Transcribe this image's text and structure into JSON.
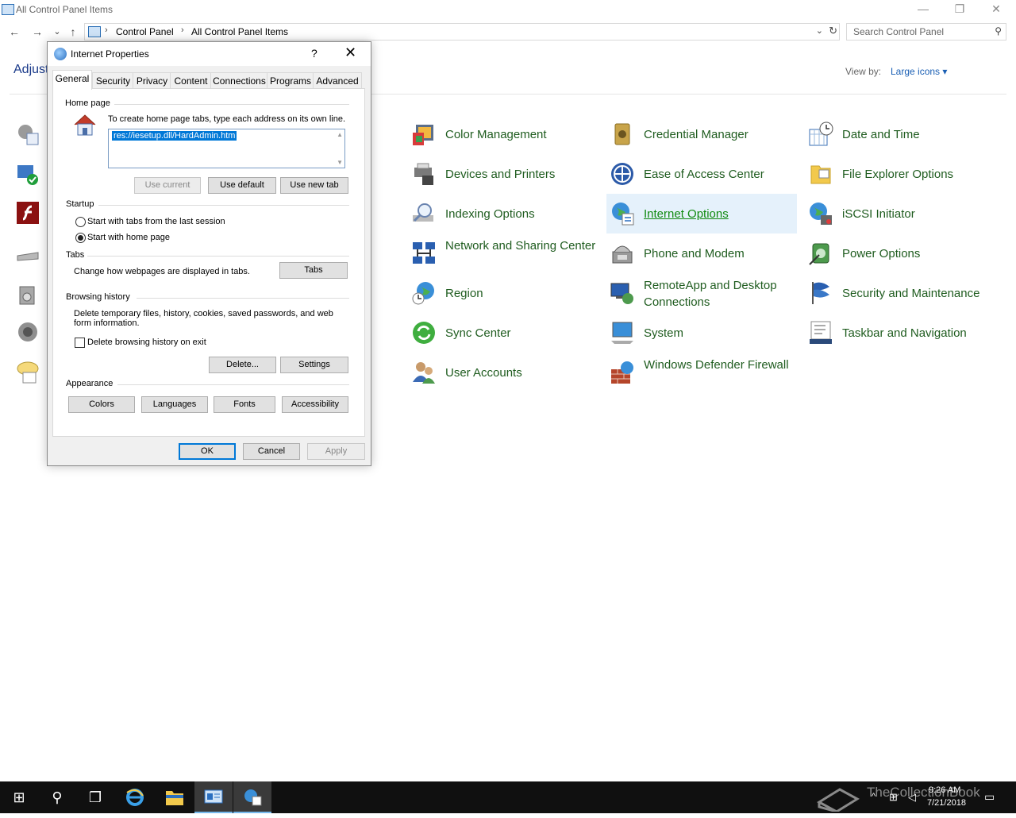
{
  "window": {
    "title": "All Control Panel Items",
    "minimize": "—",
    "restore": "❐",
    "close": "✕"
  },
  "nav": {
    "back": "←",
    "forward": "→",
    "recent": "⌄",
    "up": "↑",
    "breadcrumb": [
      "Control Panel",
      "All Control Panel Items"
    ],
    "sep": "›",
    "dropdown": "⌄",
    "refresh": "↻",
    "search_placeholder": "Search Control Panel",
    "search_glyph": "⚲"
  },
  "header": {
    "adjust": "Adjust",
    "view_by_label": "View by:",
    "view_by_value": "Large icons ▾"
  },
  "items": [
    {
      "label": "Color Management",
      "icon": "color-management-icon"
    },
    {
      "label": "Credential Manager",
      "icon": "credential-manager-icon"
    },
    {
      "label": "Date and Time",
      "icon": "date-time-icon"
    },
    {
      "label": "Devices and Printers",
      "icon": "devices-printers-icon"
    },
    {
      "label": "Ease of Access Center",
      "icon": "ease-of-access-icon"
    },
    {
      "label": "File Explorer Options",
      "icon": "file-explorer-options-icon"
    },
    {
      "label": "Indexing Options",
      "icon": "indexing-options-icon"
    },
    {
      "label": "Internet Options",
      "icon": "internet-options-icon"
    },
    {
      "label": "iSCSI Initiator",
      "icon": "iscsi-initiator-icon"
    },
    {
      "label": "Network and Sharing Center",
      "icon": "network-sharing-icon"
    },
    {
      "label": "Phone and Modem",
      "icon": "phone-modem-icon"
    },
    {
      "label": "Power Options",
      "icon": "power-options-icon"
    },
    {
      "label": "Region",
      "icon": "region-icon"
    },
    {
      "label": "RemoteApp and Desktop Connections",
      "icon": "remoteapp-icon"
    },
    {
      "label": "Security and Maintenance",
      "icon": "security-maintenance-icon"
    },
    {
      "label": "Sync Center",
      "icon": "sync-center-icon"
    },
    {
      "label": "System",
      "icon": "system-icon"
    },
    {
      "label": "Taskbar and Navigation",
      "icon": "taskbar-navigation-icon"
    },
    {
      "label": "User Accounts",
      "icon": "user-accounts-icon"
    },
    {
      "label": "Windows Defender Firewall",
      "icon": "firewall-icon"
    }
  ],
  "dialog": {
    "title": "Internet Properties",
    "help": "?",
    "close": "✕",
    "tabs": [
      "General",
      "Security",
      "Privacy",
      "Content",
      "Connections",
      "Programs",
      "Advanced"
    ],
    "home_page": {
      "group": "Home page",
      "instructions": "To create home page tabs, type each address on its own line.",
      "url": "res://iesetup.dll/HardAdmin.htm",
      "scroll_up": "▲",
      "scroll_down": "▼",
      "use_current": "Use current",
      "use_default": "Use default",
      "use_new_tab": "Use new tab"
    },
    "startup": {
      "group": "Startup",
      "option1": "Start with tabs from the last session",
      "option2": "Start with home page"
    },
    "tabs_group": {
      "group": "Tabs",
      "desc": "Change how webpages are displayed in tabs.",
      "button": "Tabs"
    },
    "history": {
      "group": "Browsing history",
      "desc": "Delete temporary files, history, cookies, saved passwords, and web form information.",
      "checkbox": "Delete browsing history on exit",
      "delete": "Delete...",
      "settings": "Settings"
    },
    "appearance": {
      "group": "Appearance",
      "colors": "Colors",
      "languages": "Languages",
      "fonts": "Fonts",
      "accessibility": "Accessibility"
    },
    "ok": "OK",
    "cancel": "Cancel",
    "apply": "Apply"
  },
  "taskbar": {
    "start": "⊞",
    "search": "⚲",
    "taskview": "❐",
    "time": "9:26 AM",
    "date": "7/21/2018",
    "watermark": "TheCollectionBook",
    "tray_up": "^",
    "network": "⊞",
    "volume": "◁",
    "notifications": "▭"
  },
  "colors": {
    "link_green": "#1f5c1f",
    "hover_blue": "#e5f1fb",
    "accent": "#0078d7"
  }
}
